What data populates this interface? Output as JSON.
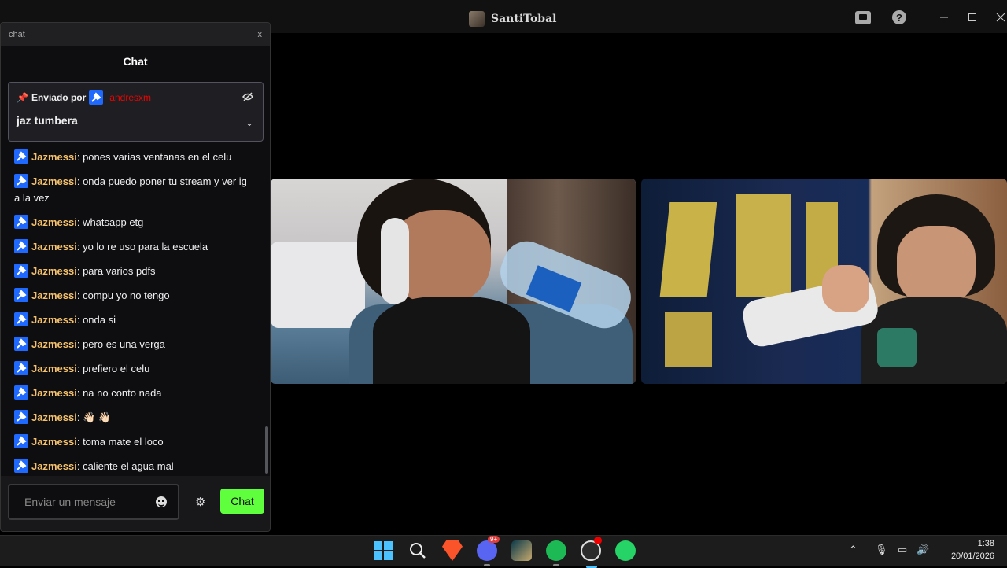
{
  "titlebar": {
    "title": "SantiTobal"
  },
  "chat_window": {
    "window_title": "chat",
    "close_label": "x",
    "header": "Chat",
    "pinned": {
      "prefix": "Enviado por",
      "sender": "andresxm",
      "text": "jaz tumbera"
    },
    "messages": [
      {
        "user": "Jazmessi",
        "text": "pones varias ventanas en el celu"
      },
      {
        "user": "Jazmessi",
        "text": "onda puedo poner tu stream y ver ig a la vez"
      },
      {
        "user": "Jazmessi",
        "text": "whatsapp etg"
      },
      {
        "user": "Jazmessi",
        "text": "yo lo re uso para la escuela"
      },
      {
        "user": "Jazmessi",
        "text": "para varios pdfs"
      },
      {
        "user": "Jazmessi",
        "text": "compu yo no tengo"
      },
      {
        "user": "Jazmessi",
        "text": "onda si"
      },
      {
        "user": "Jazmessi",
        "text": "pero es una verga"
      },
      {
        "user": "Jazmessi",
        "text": "prefiero el celu"
      },
      {
        "user": "Jazmessi",
        "text": "na no conto nada"
      },
      {
        "user": "Jazmessi",
        "text": "👋🏻 👋🏻"
      },
      {
        "user": "Jazmessi",
        "text": "toma mate el loco"
      },
      {
        "user": "Jazmessi",
        "text": "caliente el agua mal"
      }
    ],
    "input_placeholder": "Enviar un mensaje",
    "send_label": "Chat"
  },
  "taskbar": {
    "discord_badge": "9+",
    "time": "1:38",
    "date": "20/01/2026"
  },
  "colors": {
    "accent_green": "#60ff3d",
    "username": "#f5c26b",
    "pinned_sender": "#eb0400",
    "badge_blue": "#1f69ff"
  }
}
